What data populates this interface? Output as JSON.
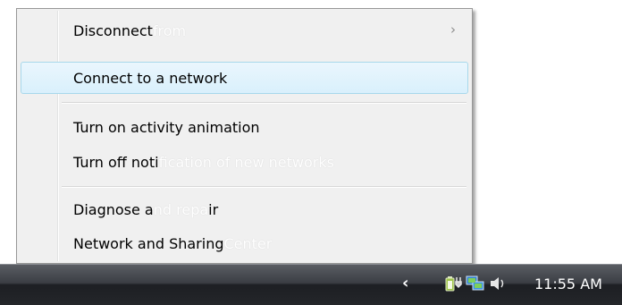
{
  "menu": {
    "items": [
      {
        "text": "Disconnect ",
        "faded": "from",
        "submenu_arrow": "›"
      },
      {
        "text": "Connect to a network",
        "faded": ""
      },
      {
        "text": "Turn on activity animation",
        "faded": ""
      },
      {
        "text": "Turn off noti",
        "faded": "fication of new networks"
      },
      {
        "text": "Diagnose a",
        "faded": "nd repa",
        "tail": "ir"
      },
      {
        "text": "Network and Sharing ",
        "faded": "Center"
      }
    ]
  },
  "taskbar": {
    "tray_chevron": "‹",
    "icons": [
      "battery-plug-icon",
      "network-icon",
      "volume-icon"
    ],
    "clock": "11:55 AM"
  },
  "colors": {
    "menu_bg": "#f0f0f0",
    "hover_border": "#a8d8eb",
    "taskbar_dark": "#1d1f23"
  }
}
